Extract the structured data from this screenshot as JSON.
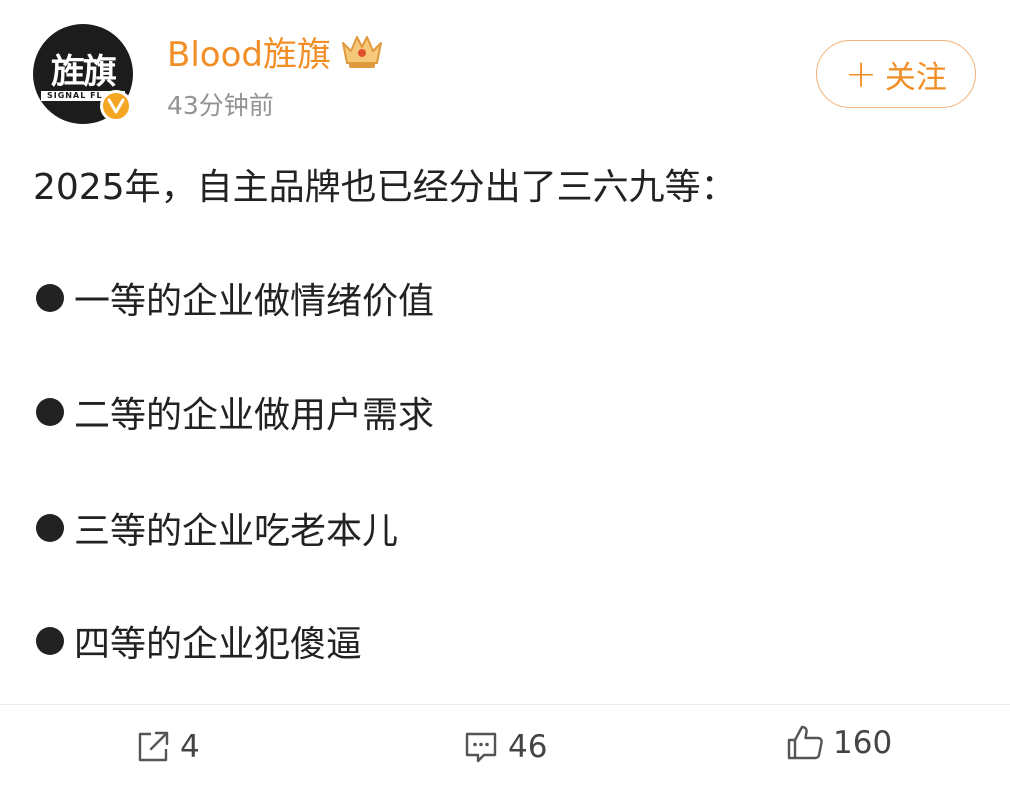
{
  "header": {
    "avatar_text": "旌旗",
    "avatar_band_text": "SIGNAL FL",
    "username": "Blood旌旗",
    "timestamp": "43分钟前",
    "follow_plus": "+",
    "follow_label": "关注"
  },
  "post": {
    "intro": "2025年，自主品牌也已经分出了三六九等：",
    "bullets": [
      "一等的企业做情绪价值",
      "二等的企业做用户需求",
      "三等的企业吃老本儿",
      "四等的企业犯傻逼"
    ]
  },
  "actions": {
    "repost_count": "4",
    "comment_count": "46",
    "like_count": "160"
  },
  "colors": {
    "username": "#f28e26",
    "follow_border": "#f3b27a",
    "verified": "#f5a623",
    "timestamp": "#939393",
    "text": "#222222"
  },
  "icons": {
    "verified": "verified-badge-icon",
    "crown": "crown-icon",
    "repost": "share-icon",
    "comment": "comment-icon",
    "like": "thumbs-up-icon"
  }
}
